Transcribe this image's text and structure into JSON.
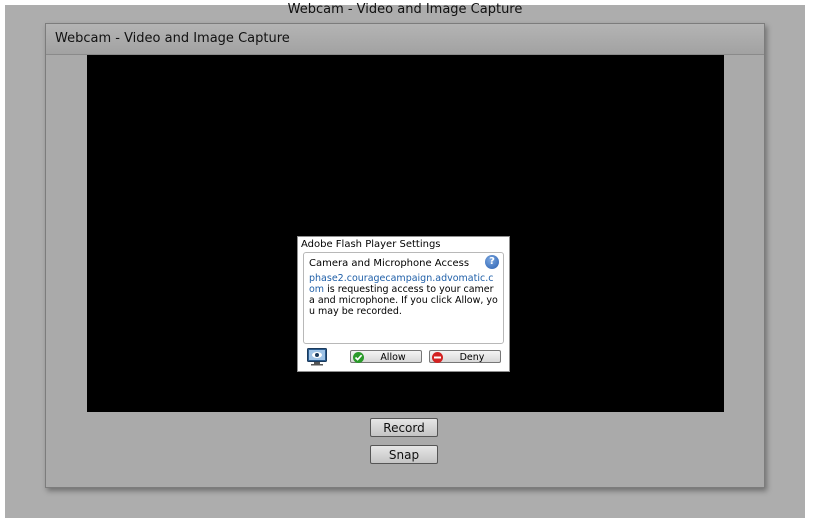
{
  "page": {
    "title": "Webcam - Video and Image Capture"
  },
  "window": {
    "title": "Webcam - Video and Image Capture"
  },
  "buttons": {
    "record_label": "Record",
    "snap_label": "Snap"
  },
  "flash_dialog": {
    "header": "Adobe Flash Player Settings",
    "section_title": "Camera and Microphone Access",
    "domain": "phase2.couragecampaign.advomatic.com",
    "message": " is requesting access to your camera and microphone. If you click Allow, you may be recorded.",
    "allow_label": "Allow",
    "deny_label": "Deny",
    "help_glyph": "?",
    "icons": {
      "help": "help-icon",
      "monitor": "monitor-icon",
      "allow": "check-icon",
      "deny": "minus-icon"
    }
  },
  "colors": {
    "video_bg": "#000000",
    "link_blue": "#1f5fa8",
    "allow_green": "#2a9a2a",
    "deny_red": "#d32222"
  }
}
